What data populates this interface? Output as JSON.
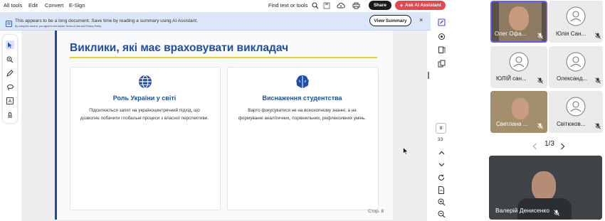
{
  "menu": {
    "items": [
      "All tools",
      "Edit",
      "Convert",
      "E-Sign"
    ],
    "find_text": "Find text or tools",
    "share_label": "Share",
    "ai_label": "Ask AI Assistant"
  },
  "banner": {
    "message": "This appears to be a long document. Save time by reading a summary using AI Assistant.",
    "fine_print": "By using this service, you agree to the Adobe Terms of Use and Privacy Policy.",
    "button_label": "View Summary",
    "close": "×"
  },
  "slide": {
    "title": "Виклики, які має враховувати викладач",
    "cards": [
      {
        "icon": "globe-icon",
        "title": "Роль України у світі",
        "body_lines": [
          "Підсилюється запит на україноцентричний підхід, що",
          "дозволяє побачити глобальні процеси з власної перспективи."
        ]
      },
      {
        "icon": "brain-icon",
        "title": "Виснаження студентства",
        "body_lines": [
          "Варто фокусуватися не на всеохопному знанні, а на",
          "формуванні аналітичних, порівняльних, рефлексивних умінь."
        ]
      }
    ],
    "page_label": "Стор. 8"
  },
  "navigation": {
    "current_page": "8",
    "total_pages": "33"
  },
  "meeting": {
    "participants": [
      {
        "name": "Олег Офа...",
        "muted": true,
        "video": true,
        "active": true
      },
      {
        "name": "Юлія Сан...",
        "muted": true,
        "video": false
      },
      {
        "name": "ЮЛІЙ сан...",
        "muted": true,
        "video": false
      },
      {
        "name": "Олександ...",
        "muted": true,
        "video": false
      },
      {
        "name": "Светлана ...",
        "muted": true,
        "video": true
      },
      {
        "name": "Світюков...",
        "muted": true,
        "video": false
      }
    ],
    "pager": "1/3",
    "speaker": {
      "name": "Валерій Денисенко",
      "muted": true
    }
  },
  "colors": {
    "accent_blue": "#1e4ea5",
    "title_underline": "#f3cd1f",
    "ai_button": "#e34850",
    "banner_bg": "#dbe6f8"
  }
}
